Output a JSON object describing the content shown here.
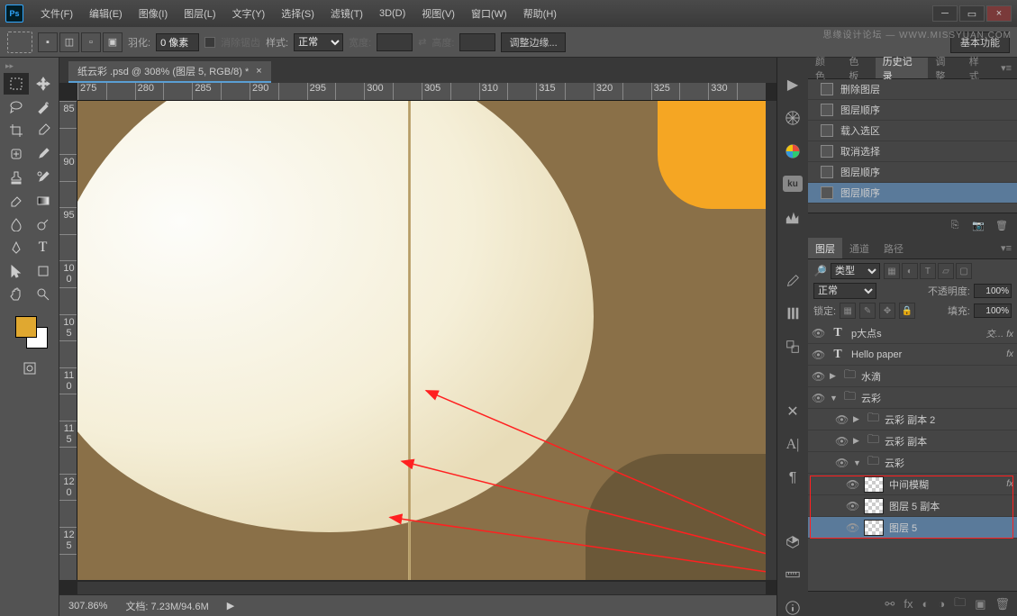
{
  "watermark": "思缘设计论坛 — WWW.MISSYUAN.COM",
  "menu": [
    "文件(F)",
    "编辑(E)",
    "图像(I)",
    "图层(L)",
    "文字(Y)",
    "选择(S)",
    "滤镜(T)",
    "3D(D)",
    "视图(V)",
    "窗口(W)",
    "帮助(H)"
  ],
  "options": {
    "feather_label": "羽化:",
    "feather_value": "0 像素",
    "antialias": "消除锯齿",
    "style_label": "样式:",
    "style_value": "正常",
    "width_label": "宽度:",
    "height_label": "高度:",
    "refine": "调整边缘...",
    "basic": "基本功能"
  },
  "doc": {
    "tab": "纸云彩 .psd @ 308% (图层 5, RGB/8) *",
    "close": "×",
    "zoom": "307.86%",
    "filesize": "文档: 7.23M/94.6M",
    "ruler_h": [
      "275",
      "",
      "280",
      "",
      "285",
      "",
      "290",
      "",
      "295",
      "",
      "300",
      "",
      "305",
      "",
      "310",
      "",
      "315",
      "",
      "320",
      "",
      "325",
      "",
      "330",
      ""
    ],
    "ruler_v": [
      "85",
      "",
      "90",
      "",
      "95",
      "",
      "10 0",
      "",
      "10 5",
      "",
      "11 0",
      "",
      "11 5",
      "",
      "12 0",
      "",
      "12 5",
      ""
    ]
  },
  "panels": {
    "top_tabs": [
      "颜色",
      "色板",
      "历史记录",
      "调整",
      "样式"
    ],
    "history": [
      "删除图层",
      "图层顺序",
      "载入选区",
      "取消选择",
      "图层顺序",
      "图层顺序"
    ],
    "layer_tabs": [
      "图层",
      "通道",
      "路径"
    ],
    "kind": "类型",
    "blend": "正常",
    "opacity_label": "不透明度:",
    "opacity": "100%",
    "lock_label": "锁定:",
    "fill_label": "填充:",
    "fill": "100%",
    "layers": [
      {
        "type": "T",
        "name": "p大点s",
        "fx": "交… fx"
      },
      {
        "type": "T",
        "name": "Hello paper",
        "fx": "fx"
      },
      {
        "type": "folder",
        "name": "水滴",
        "arrow": "▶"
      },
      {
        "type": "folder",
        "name": "云彩",
        "arrow": "▼"
      },
      {
        "type": "folder",
        "name": "云彩 副本 2",
        "arrow": "▶",
        "indent": 2
      },
      {
        "type": "folder",
        "name": "云彩 副本",
        "arrow": "▶",
        "indent": 2
      },
      {
        "type": "folder",
        "name": "云彩",
        "arrow": "▼",
        "indent": 2
      },
      {
        "type": "thumb",
        "name": "中间模糊",
        "indent": 3,
        "fx": "fx"
      },
      {
        "type": "thumb",
        "name": "图层 5 副本",
        "indent": 3
      },
      {
        "type": "thumb",
        "name": "图层 5",
        "indent": 3,
        "sel": true
      }
    ]
  }
}
